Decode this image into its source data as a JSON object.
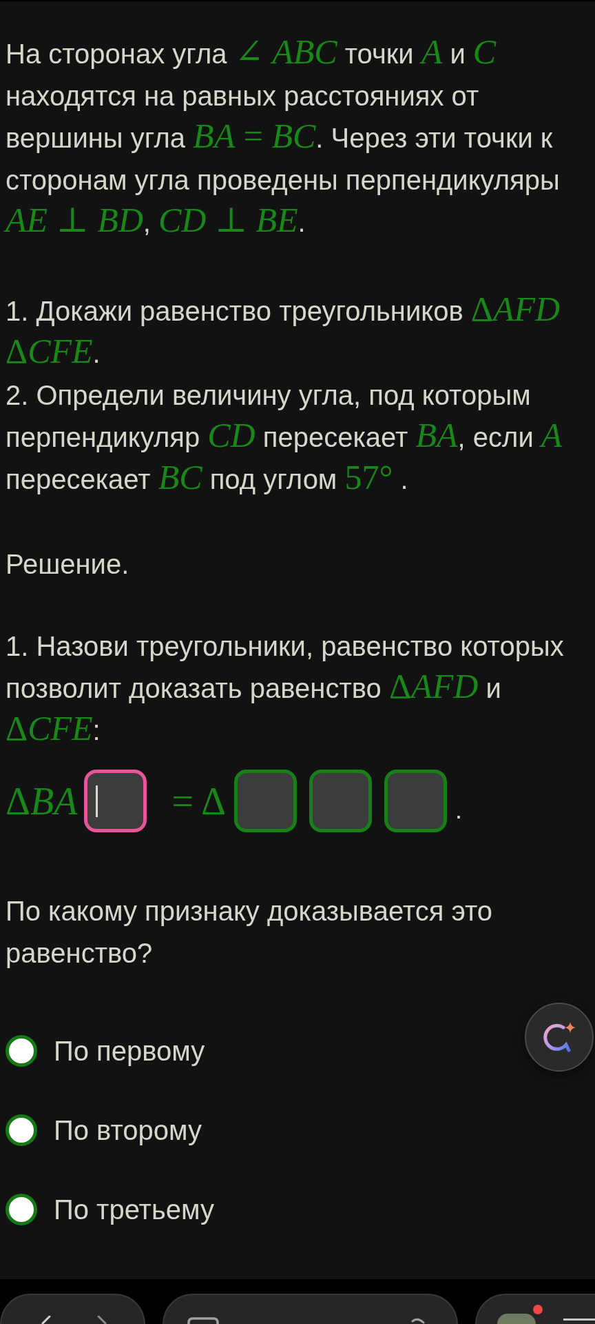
{
  "statement": {
    "segments": [
      {
        "kind": "text",
        "text": "На сторонах угла "
      },
      {
        "kind": "math",
        "text": "∠ ABC"
      },
      {
        "kind": "text",
        "text": " точки "
      },
      {
        "kind": "math",
        "text": "A"
      },
      {
        "kind": "text",
        "text": " и "
      },
      {
        "kind": "math",
        "text": "C"
      },
      {
        "kind": "text",
        "text": " находятся на равных расстояниях от вершины угла "
      },
      {
        "kind": "math",
        "text": "BA = BC"
      },
      {
        "kind": "text",
        "text": ". Через эти точки к сторонам угла проведены перпендикуляры "
      },
      {
        "kind": "math",
        "text": "AE ⊥ BD"
      },
      {
        "kind": "text",
        "text": ", "
      },
      {
        "kind": "math",
        "text": "CD ⊥ BE"
      },
      {
        "kind": "text",
        "text": "."
      }
    ]
  },
  "tasks": [
    {
      "segments": [
        {
          "kind": "text",
          "text": "1. Докажи равенство треугольников "
        },
        {
          "kind": "math",
          "text": "ΔAFD"
        },
        {
          "kind": "math",
          "text": "ΔCFE"
        },
        {
          "kind": "text",
          "text": "."
        }
      ]
    },
    {
      "segments": [
        {
          "kind": "text",
          "text": "2. Определи величину угла, под которым перпендикуляр "
        },
        {
          "kind": "math",
          "text": "CD"
        },
        {
          "kind": "text",
          "text": " пересекает "
        },
        {
          "kind": "math",
          "text": "BA"
        },
        {
          "kind": "text",
          "text": ", если "
        },
        {
          "kind": "math",
          "text": "A"
        },
        {
          "kind": "text",
          "text": " пересекает "
        },
        {
          "kind": "math",
          "text": "BC"
        },
        {
          "kind": "text",
          "text": " под углом "
        },
        {
          "kind": "math",
          "text": "57°"
        },
        {
          "kind": "text",
          "text": " ."
        }
      ]
    }
  ],
  "solution_heading": "Решение.",
  "step": {
    "segments": [
      {
        "kind": "text",
        "text": "1. Назови треугольники, равенство которых позволит доказать равенство "
      },
      {
        "kind": "math",
        "text": "ΔAFD"
      },
      {
        "kind": "text",
        "text": " и "
      },
      {
        "kind": "math",
        "text": "ΔCFE"
      },
      {
        "kind": "text",
        "text": ":"
      }
    ]
  },
  "answer_row": [
    {
      "kind": "math",
      "text": "ΔBA"
    },
    {
      "kind": "box",
      "focused": true
    },
    {
      "kind": "math",
      "text": "= Δ"
    },
    {
      "kind": "box",
      "focused": false
    },
    {
      "kind": "box",
      "focused": false
    },
    {
      "kind": "box",
      "focused": false
    },
    {
      "kind": "text",
      "text": "."
    }
  ],
  "prompt": "По какому признаку доказывается это равенство?",
  "options": [
    {
      "label": "По первому",
      "selected": false
    },
    {
      "label": "По второму",
      "selected": false
    },
    {
      "label": "По третьему",
      "selected": false
    }
  ]
}
